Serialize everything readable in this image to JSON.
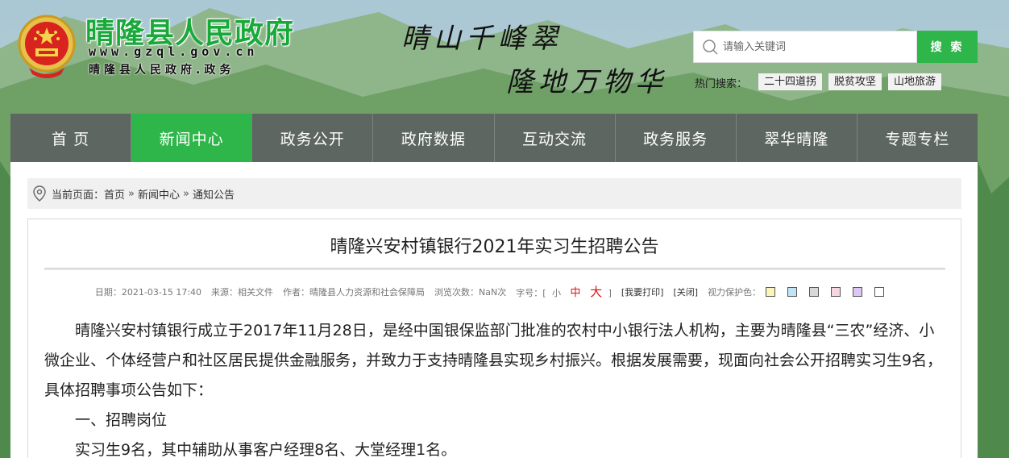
{
  "header": {
    "site_title": "晴隆县人民政府",
    "site_url": "www.gzql.gov.cn",
    "site_subtitle": "晴隆县人民政府.政务",
    "slogan_line1": "晴山千峰翠",
    "slogan_line2": "隆地万物华",
    "search": {
      "placeholder": "请输入关键词",
      "button_label": "搜 索"
    },
    "hot_search": {
      "label": "热门搜索：",
      "tags": [
        "二十四道拐",
        "脱贫攻坚",
        "山地旅游"
      ]
    }
  },
  "nav": {
    "items": [
      {
        "label": "首 页",
        "active": false
      },
      {
        "label": "新闻中心",
        "active": true
      },
      {
        "label": "政务公开",
        "active": false
      },
      {
        "label": "政府数据",
        "active": false
      },
      {
        "label": "互动交流",
        "active": false
      },
      {
        "label": "政务服务",
        "active": false
      },
      {
        "label": "翠华晴隆",
        "active": false
      },
      {
        "label": "专题专栏",
        "active": false
      }
    ]
  },
  "breadcrumb": {
    "prefix": "当前页面：",
    "items": [
      "首页",
      "新闻中心",
      "通知公告"
    ],
    "separator": "»"
  },
  "article": {
    "title": "晴隆兴安村镇银行2021年实习生招聘公告",
    "meta": {
      "date": "日期：2021-03-15 17:40",
      "source": "来源：相关文件",
      "author": "作者：晴隆县人力资源和社会保障局",
      "views": "浏览次数：NaN次",
      "font_label": "字号：[",
      "font_small": "小",
      "font_medium": "中",
      "font_large": "大",
      "font_close": "]",
      "print": "[我要打印]",
      "close": "[关闭]",
      "eye_protect": "视力保护色："
    },
    "swatch_colors": [
      "#fbf5b8",
      "#bfe4f5",
      "#d8d8d8",
      "#f7d5e3",
      "#dcc7f2",
      "#ffffff"
    ],
    "paragraphs": [
      "晴隆兴安村镇银行成立于2017年11月28日，是经中国银保监部门批准的农村中小银行法人机构，主要为晴隆县“三农”经济、小微企业、个体经营户和社区居民提供金融服务，并致力于支持晴隆县实现乡村振兴。根据发展需要，现面向社会公开招聘实习生9名，具体招聘事项公告如下：",
      "一、招聘岗位",
      "实习生9名，其中辅助从事客户经理8名、大堂经理1名。"
    ]
  },
  "colors": {
    "accent_green": "#2eb64a",
    "nav_gray": "#5d6660",
    "title_green": "#19a93a"
  }
}
